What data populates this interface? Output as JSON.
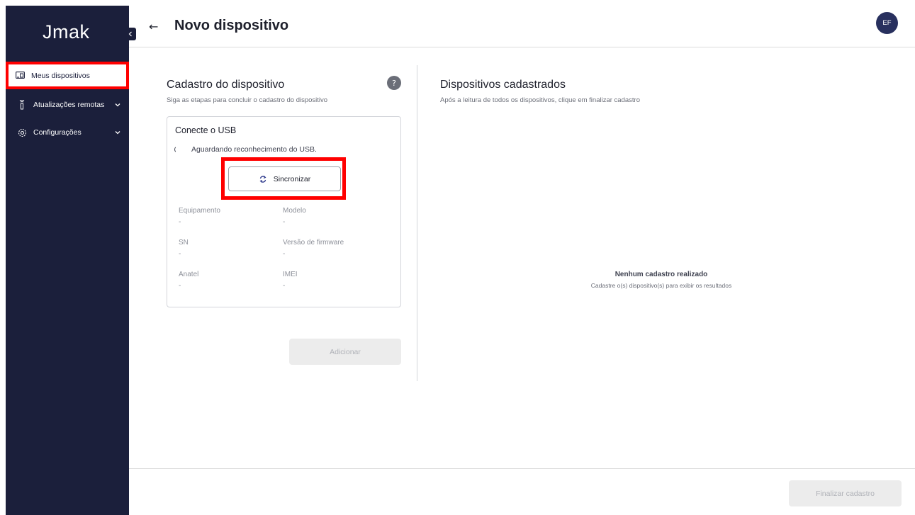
{
  "app": {
    "logo": "Jmak"
  },
  "sidebar": {
    "items": [
      {
        "label": "Meus dispositivos",
        "icon": "devices-icon",
        "active": true
      },
      {
        "label": "Atualizações remotas",
        "icon": "antenna-icon",
        "expandable": true
      },
      {
        "label": "Configurações",
        "icon": "gear-icon",
        "expandable": true
      }
    ]
  },
  "header": {
    "title": "Novo dispositivo",
    "back_icon": "arrow-left-icon",
    "avatar_initials": "EF"
  },
  "register": {
    "title": "Cadastro do dispositivo",
    "subtitle": "Siga as etapas para concluir o cadastro do dispositivo",
    "card": {
      "title": "Conecte o USB",
      "status": "Aguardando reconhecimento do USB.",
      "sync_label": "Sincronizar",
      "fields": [
        {
          "label": "Equipamento",
          "value": "-"
        },
        {
          "label": "Modelo",
          "value": "-"
        },
        {
          "label": "SN",
          "value": "-"
        },
        {
          "label": "Versão de firmware",
          "value": "-"
        },
        {
          "label": "Anatel",
          "value": "-"
        },
        {
          "label": "IMEI",
          "value": "-"
        }
      ]
    },
    "add_label": "Adicionar"
  },
  "registered": {
    "title": "Dispositivos cadastrados",
    "subtitle": "Após a leitura de todos os dispositivos, clique em finalizar cadastro",
    "empty_title": "Nenhum cadastro realizado",
    "empty_subtitle": "Cadastre o(s) dispositivo(s) para exibir os resultados"
  },
  "footer": {
    "finish_label": "Finalizar cadastro"
  },
  "colors": {
    "sidebar": "#1b1f3b",
    "highlight": "#ff0000",
    "avatar": "#28305e"
  }
}
